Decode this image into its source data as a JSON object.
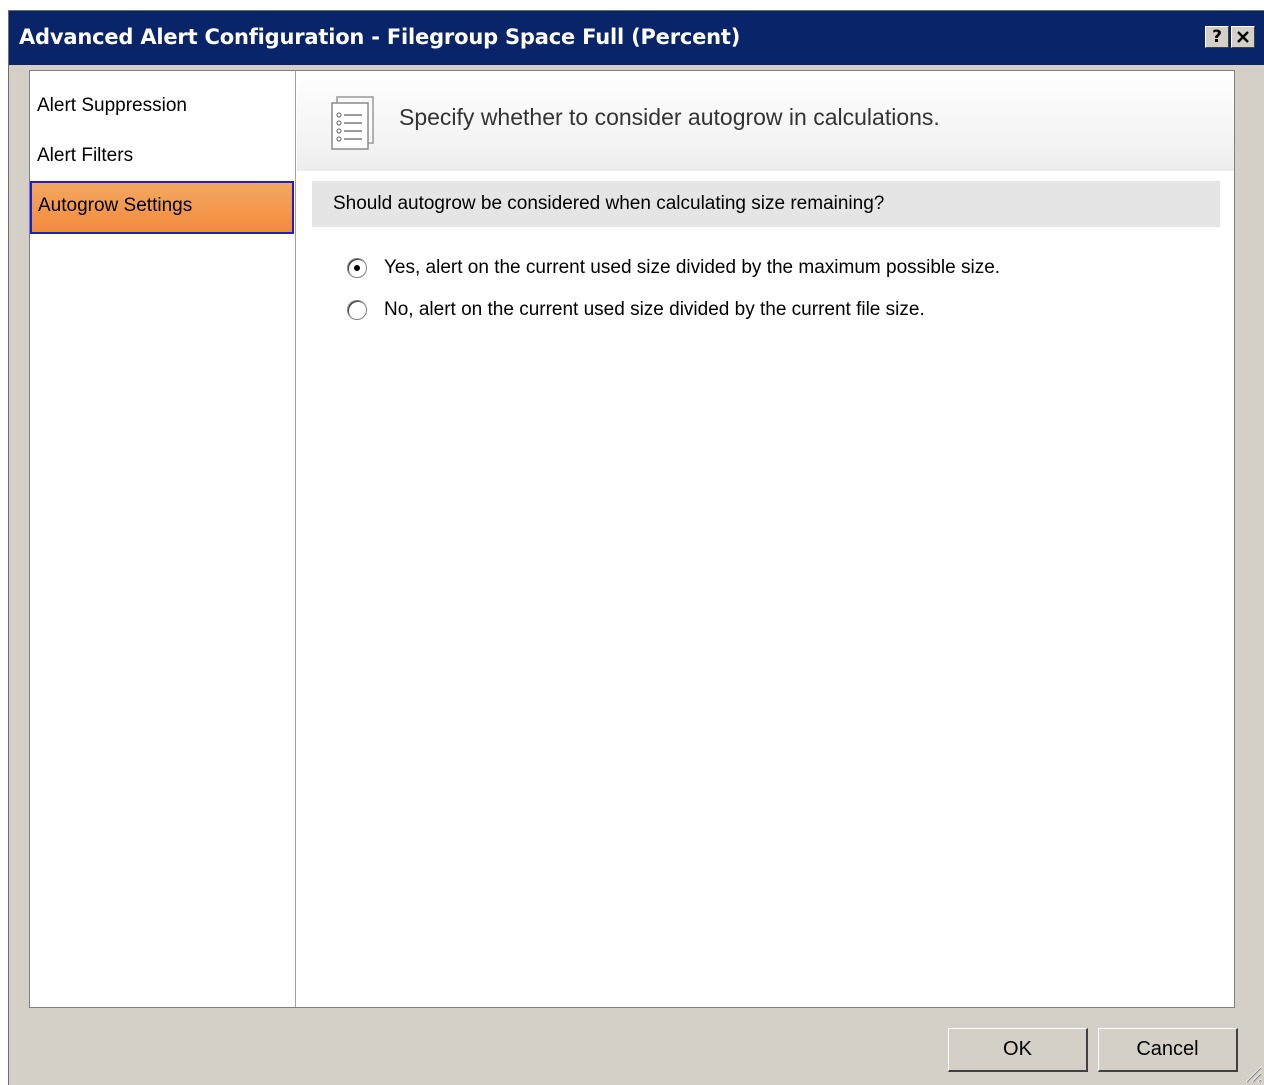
{
  "window": {
    "title": "Advanced Alert Configuration - Filegroup Space Full (Percent)",
    "help_button": "?",
    "close_button": "✕"
  },
  "sidebar": {
    "items": [
      {
        "label": "Alert Suppression"
      },
      {
        "label": "Alert Filters"
      },
      {
        "label": "Autogrow Settings",
        "selected": true
      }
    ]
  },
  "main": {
    "header_text": "Specify whether to consider autogrow in calculations.",
    "header_icon": "document-list-icon",
    "question": "Should autogrow be considered when calculating size remaining?",
    "options": [
      {
        "label": "Yes, alert on the current used size divided by the maximum possible size.",
        "checked": true
      },
      {
        "label": "No, alert on the current used size divided by the current file size.",
        "checked": false
      }
    ]
  },
  "footer": {
    "ok_label": "OK",
    "cancel_label": "Cancel"
  },
  "colors": {
    "titlebar": "#0a246a",
    "selected_item": "#f28b3c",
    "selected_border": "#1a1fd6",
    "dialog_bg": "#d4d0c8"
  }
}
